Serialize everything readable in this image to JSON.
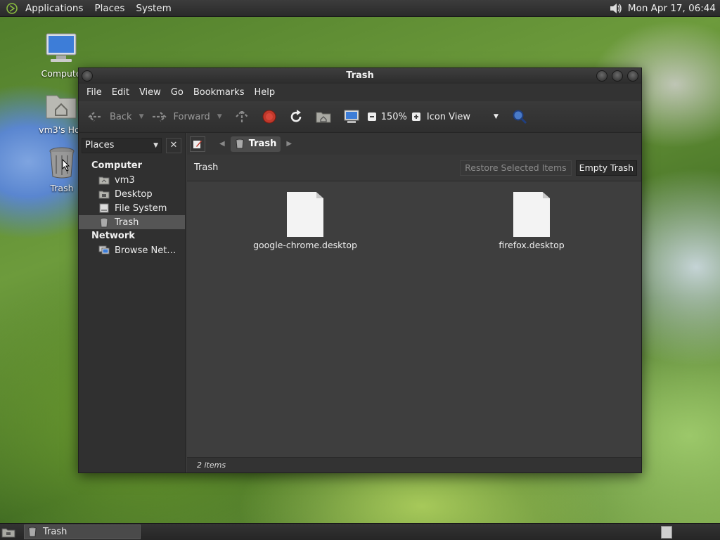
{
  "top_panel": {
    "menus": [
      "Applications",
      "Places",
      "System"
    ],
    "clock": "Mon Apr 17, 06:44"
  },
  "desktop_icons": [
    {
      "label": "Compute"
    },
    {
      "label": "vm3's Hor"
    },
    {
      "label": "Trash"
    }
  ],
  "window": {
    "title": "Trash",
    "menu": [
      "File",
      "Edit",
      "View",
      "Go",
      "Bookmarks",
      "Help"
    ],
    "toolbar": {
      "back": "Back",
      "forward": "Forward",
      "zoom": "150%",
      "view_mode": "Icon View"
    },
    "sidebar": {
      "combo_label": "Places",
      "sections": [
        {
          "title": "Computer",
          "items": [
            "vm3",
            "Desktop",
            "File System",
            "Trash"
          ]
        },
        {
          "title": "Network",
          "items": [
            "Browse Net…"
          ]
        }
      ],
      "selected": "Trash"
    },
    "pathbar": {
      "crumb": "Trash"
    },
    "infobar": {
      "title": "Trash",
      "restore_label": "Restore Selected Items",
      "empty_label": "Empty Trash"
    },
    "files": [
      {
        "name": "google-chrome.desktop"
      },
      {
        "name": "firefox.desktop"
      }
    ],
    "status": "2 items"
  },
  "bottom_panel": {
    "task_label": "Trash"
  }
}
